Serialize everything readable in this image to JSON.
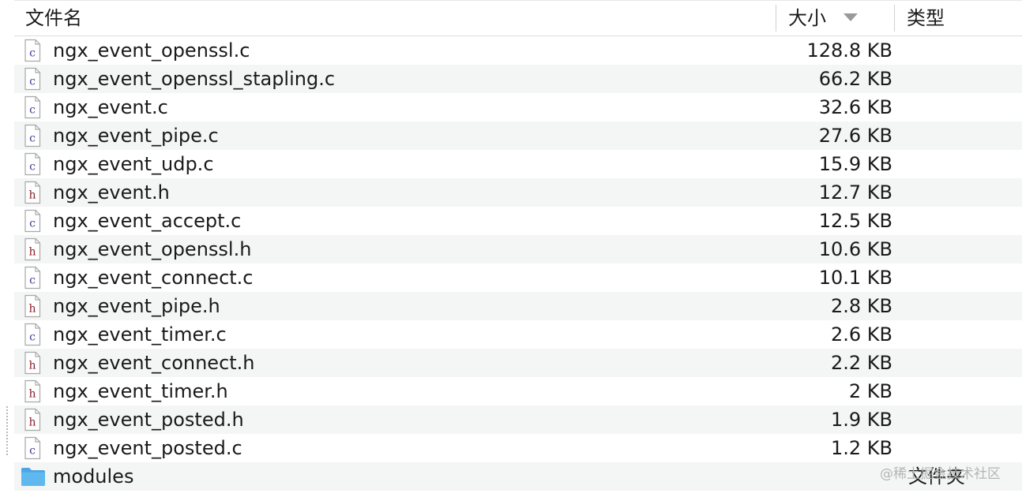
{
  "header": {
    "name_label": "文件名",
    "size_label": "大小",
    "kind_label": "类型"
  },
  "files": [
    {
      "name": "ngx_event_openssl.c",
      "size": "128.8 KB",
      "type": "c"
    },
    {
      "name": "ngx_event_openssl_stapling.c",
      "size": "66.2 KB",
      "type": "c"
    },
    {
      "name": "ngx_event.c",
      "size": "32.6 KB",
      "type": "c"
    },
    {
      "name": "ngx_event_pipe.c",
      "size": "27.6 KB",
      "type": "c"
    },
    {
      "name": "ngx_event_udp.c",
      "size": "15.9 KB",
      "type": "c"
    },
    {
      "name": "ngx_event.h",
      "size": "12.7 KB",
      "type": "h"
    },
    {
      "name": "ngx_event_accept.c",
      "size": "12.5 KB",
      "type": "c"
    },
    {
      "name": "ngx_event_openssl.h",
      "size": "10.6 KB",
      "type": "h"
    },
    {
      "name": "ngx_event_connect.c",
      "size": "10.1 KB",
      "type": "c"
    },
    {
      "name": "ngx_event_pipe.h",
      "size": "2.8 KB",
      "type": "h"
    },
    {
      "name": "ngx_event_timer.c",
      "size": "2.6 KB",
      "type": "c"
    },
    {
      "name": "ngx_event_connect.h",
      "size": "2.2 KB",
      "type": "h"
    },
    {
      "name": "ngx_event_timer.h",
      "size": "2 KB",
      "type": "h"
    },
    {
      "name": "ngx_event_posted.h",
      "size": "1.9 KB",
      "type": "h"
    },
    {
      "name": "ngx_event_posted.c",
      "size": "1.2 KB",
      "type": "c"
    }
  ],
  "folder": {
    "name": "modules",
    "kind": "文件夹"
  },
  "watermark": "@稀土掘金技术社区",
  "colors": {
    "c_letter": "#3b3f8f",
    "h_letter": "#8b1a2a",
    "folder": "#5fb8ee",
    "row_alt": "#f4f5f5"
  },
  "icons": {
    "c_file": "c-source-file-icon",
    "h_file": "h-header-file-icon",
    "folder": "folder-icon",
    "sort": "sort-descending-icon"
  }
}
